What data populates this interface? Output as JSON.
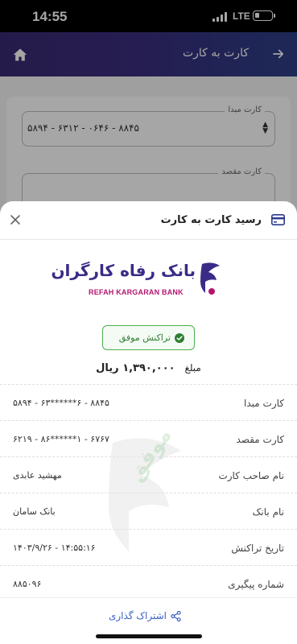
{
  "status_bar": {
    "time": "14:55",
    "network": "LTE",
    "battery_level": 0.3
  },
  "header": {
    "title": "کارت به کارت",
    "home_icon": "home-icon",
    "back_icon": "arrow-right-icon",
    "gradient_start": "#3a2a72",
    "gradient_end": "#2c3f86"
  },
  "form": {
    "source_label": "کارت مبدا",
    "source_value": "۵۸۹۴ - ۶۳۱۲ - ۰۶۴۶ - ۸۸۴۵",
    "dest_label": "کارت مقصد"
  },
  "receipt": {
    "title": "رسید کارت به کارت",
    "bank_name_fa": "بانک رفاه کارگران",
    "bank_name_en": "REFAH KARGARAN BANK",
    "status": "تراکنش موفق",
    "amount_label": "مبلغ",
    "amount_value": "۱,۳۹۰,۰۰۰ ریال",
    "watermark": "موفق",
    "rows": [
      {
        "label": "کارت مبدا",
        "value": "۵۸۹۴ - ۶۳******۶ - ۸۸۴۵"
      },
      {
        "label": "کارت مقصد",
        "value": "۶۲۱۹ - ۸۶******۱ - ۶۷۶۷"
      },
      {
        "label": "نام صاحب کارت",
        "value": "مهشید عابدی"
      },
      {
        "label": "نام بانک",
        "value": "بانک سامان"
      },
      {
        "label": "تاریخ تراکنش",
        "value": "۱۴۰۳/۹/۲۶ - ۱۴:۵۵:۱۶"
      },
      {
        "label": "شماره پیگیری",
        "value": "۸۸۵۰۹۶"
      }
    ],
    "share_label": "اشتراک گذاری"
  },
  "colors": {
    "accent": "#3b2b86",
    "success": "#4caf50",
    "brand_pink": "#b4156f",
    "link": "#3b5fc4"
  }
}
